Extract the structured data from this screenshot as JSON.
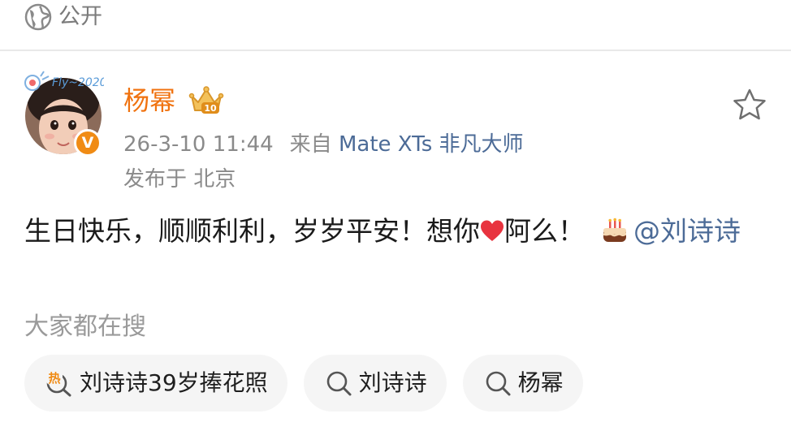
{
  "visibility": {
    "icon": "globe-icon",
    "label": "公开"
  },
  "post": {
    "author": {
      "name": "杨幂",
      "avatar_caption": "Fly~2020",
      "verified_badge": "V",
      "level_badge": "10",
      "name_color": "#f0720f"
    },
    "timestamp": "26-3-10 11:44",
    "source_prefix": "来自",
    "source_device": "Mate XTs 非凡大师",
    "location_label": "发布于 北京",
    "text_part1": "生日快乐，顺顺利利，岁岁平安！想你",
    "text_part2": "阿么！",
    "heart_emoji": "❤",
    "cake_emoji": "🎂",
    "mention": "@刘诗诗",
    "favorite_icon": "star-icon"
  },
  "search_suggestions": {
    "heading": "大家都在搜",
    "items": [
      {
        "icon": "hot-search-icon",
        "icon_label": "热",
        "label": "刘诗诗39岁捧花照"
      },
      {
        "icon": "search-icon",
        "label": "刘诗诗"
      },
      {
        "icon": "search-icon",
        "label": "杨幂"
      }
    ]
  },
  "colors": {
    "link": "#4c6b97",
    "muted": "#8a8a8a",
    "hot": "#f08b14",
    "chip_bg": "#f5f5f5"
  }
}
